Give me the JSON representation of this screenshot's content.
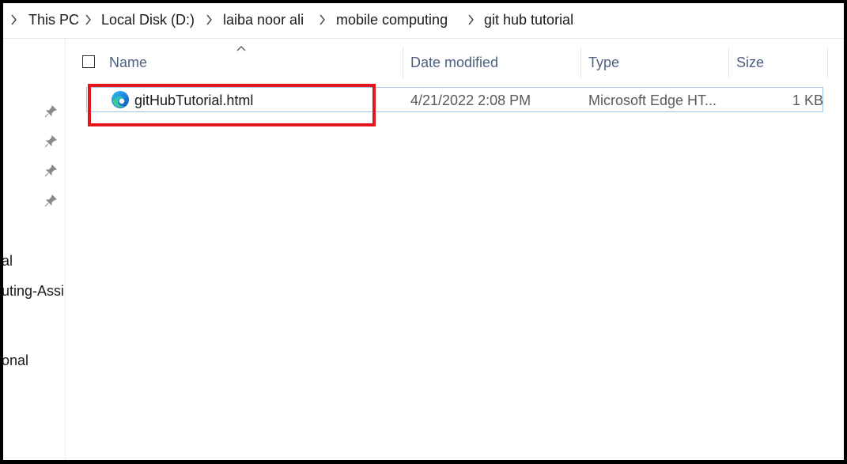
{
  "breadcrumb": {
    "items": [
      "This PC",
      "Local Disk (D:)",
      "laiba noor ali",
      "mobile computing",
      "git hub tutorial"
    ]
  },
  "nav_pane": {
    "partial_labels": [
      "al",
      "uting-Assi",
      "onal"
    ]
  },
  "file_list": {
    "columns": {
      "name": "Name",
      "date_modified": "Date modified",
      "type": "Type",
      "size": "Size"
    },
    "sort": {
      "column": "Name",
      "direction": "ascending"
    },
    "files": [
      {
        "name": "gitHubTutorial.html",
        "date_modified": "4/21/2022 2:08 PM",
        "type": "Microsoft Edge HT...",
        "size": "1 KB",
        "icon": "edge-html-file-icon",
        "selected": true
      }
    ]
  },
  "annotation": {
    "color": "#e3151f",
    "target": "gitHubTutorial.html"
  }
}
